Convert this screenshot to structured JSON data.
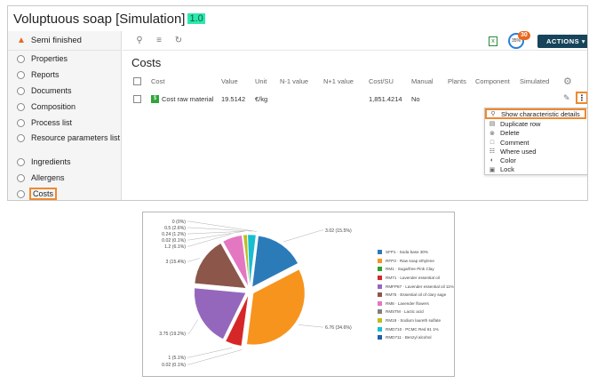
{
  "app": {
    "title": "Voluptuous soap [Simulation]",
    "version": "1.0"
  },
  "sidebar": {
    "header": "Semi finished",
    "items": [
      {
        "label": "Properties"
      },
      {
        "label": "Reports"
      },
      {
        "label": "Documents"
      },
      {
        "label": "Composition"
      },
      {
        "label": "Process list"
      },
      {
        "label": "Resource parameters list"
      },
      {
        "label": "Ingredients"
      },
      {
        "label": "Allergens"
      },
      {
        "label": "Costs",
        "active": true
      }
    ]
  },
  "toolbar": {
    "icons": [
      "search-icon",
      "filter-list-icon",
      "refresh-icon"
    ],
    "progress_label": "35%",
    "notification_count": "30",
    "actions_label": "ACTIONS ▾"
  },
  "costs": {
    "heading": "Costs",
    "columns": [
      "Cost",
      "Value",
      "Unit",
      "N-1 value",
      "N+1 value",
      "Cost/SU",
      "Manual",
      "Plants",
      "Component",
      "Simulated"
    ],
    "rows": [
      {
        "cost": "Cost raw material",
        "value": "19.5142",
        "unit": "€/kg",
        "n1": "",
        "np1": "",
        "cost_su": "1,851.4214",
        "manual": "No",
        "plants": "",
        "component": "",
        "simulated": ""
      }
    ]
  },
  "context_menu": {
    "items": [
      {
        "label": "Show characteristic details",
        "icon": "search-icon"
      },
      {
        "label": "Duplicate row",
        "icon": "duplicate-icon"
      },
      {
        "label": "Delete",
        "icon": "delete-icon"
      },
      {
        "label": "Comment",
        "icon": "comment-icon"
      },
      {
        "label": "Where used",
        "icon": "where-used-icon"
      },
      {
        "label": "Color",
        "icon": "color-icon"
      },
      {
        "label": "Lock",
        "icon": "lock-icon"
      }
    ]
  },
  "chart_data": {
    "type": "pie",
    "slices": [
      {
        "label": "3.02 (15.5%)",
        "value": 3.02,
        "color": "#2b7bb9",
        "legend": "SFP1 · Soda base 30%"
      },
      {
        "label": "6.76 (34.6%)",
        "value": 6.76,
        "color": "#f7941d",
        "legend": "RFP3 · Raw soap ethylene"
      },
      {
        "label": "0.02 (0.1%)",
        "value": 0.02,
        "color": "#2ca02c",
        "legend": "RM1 · Sugarfree Pink Clay"
      },
      {
        "label": "1 (5.1%)",
        "value": 1.0,
        "color": "#d62728",
        "legend": "RM71 · Lavender essential oil"
      },
      {
        "label": "3.75 (19.2%)",
        "value": 3.75,
        "color": "#9467bd",
        "legend": "RMFP87 · Lavender essential oil 11%"
      },
      {
        "label": "3 (15.4%)",
        "value": 3.0,
        "color": "#8c564b",
        "legend": "RM75 · Essential oil of clary sage"
      },
      {
        "label": "1.2 (6.1%)",
        "value": 1.2,
        "color": "#e377c2",
        "legend": "RM8 · Lavender flowers"
      },
      {
        "label": "0.02 (0.1%)",
        "value": 0.02,
        "color": "#7f7f7f",
        "legend": "RMSTM · Lactic acid"
      },
      {
        "label": "0.24 (1.2%)",
        "value": 0.24,
        "color": "#bcbd22",
        "legend": "RM19 · Sodium laureth sulfate"
      },
      {
        "label": "0.5 (2.6%)",
        "value": 0.5,
        "color": "#17becf",
        "legend": "RMD710 · PCMC Red 61 1%"
      },
      {
        "label": "0 (0%)",
        "value": 0.001,
        "color": "#1f5fa8",
        "legend": "RMD711 · Benzyl alcohol"
      }
    ]
  }
}
